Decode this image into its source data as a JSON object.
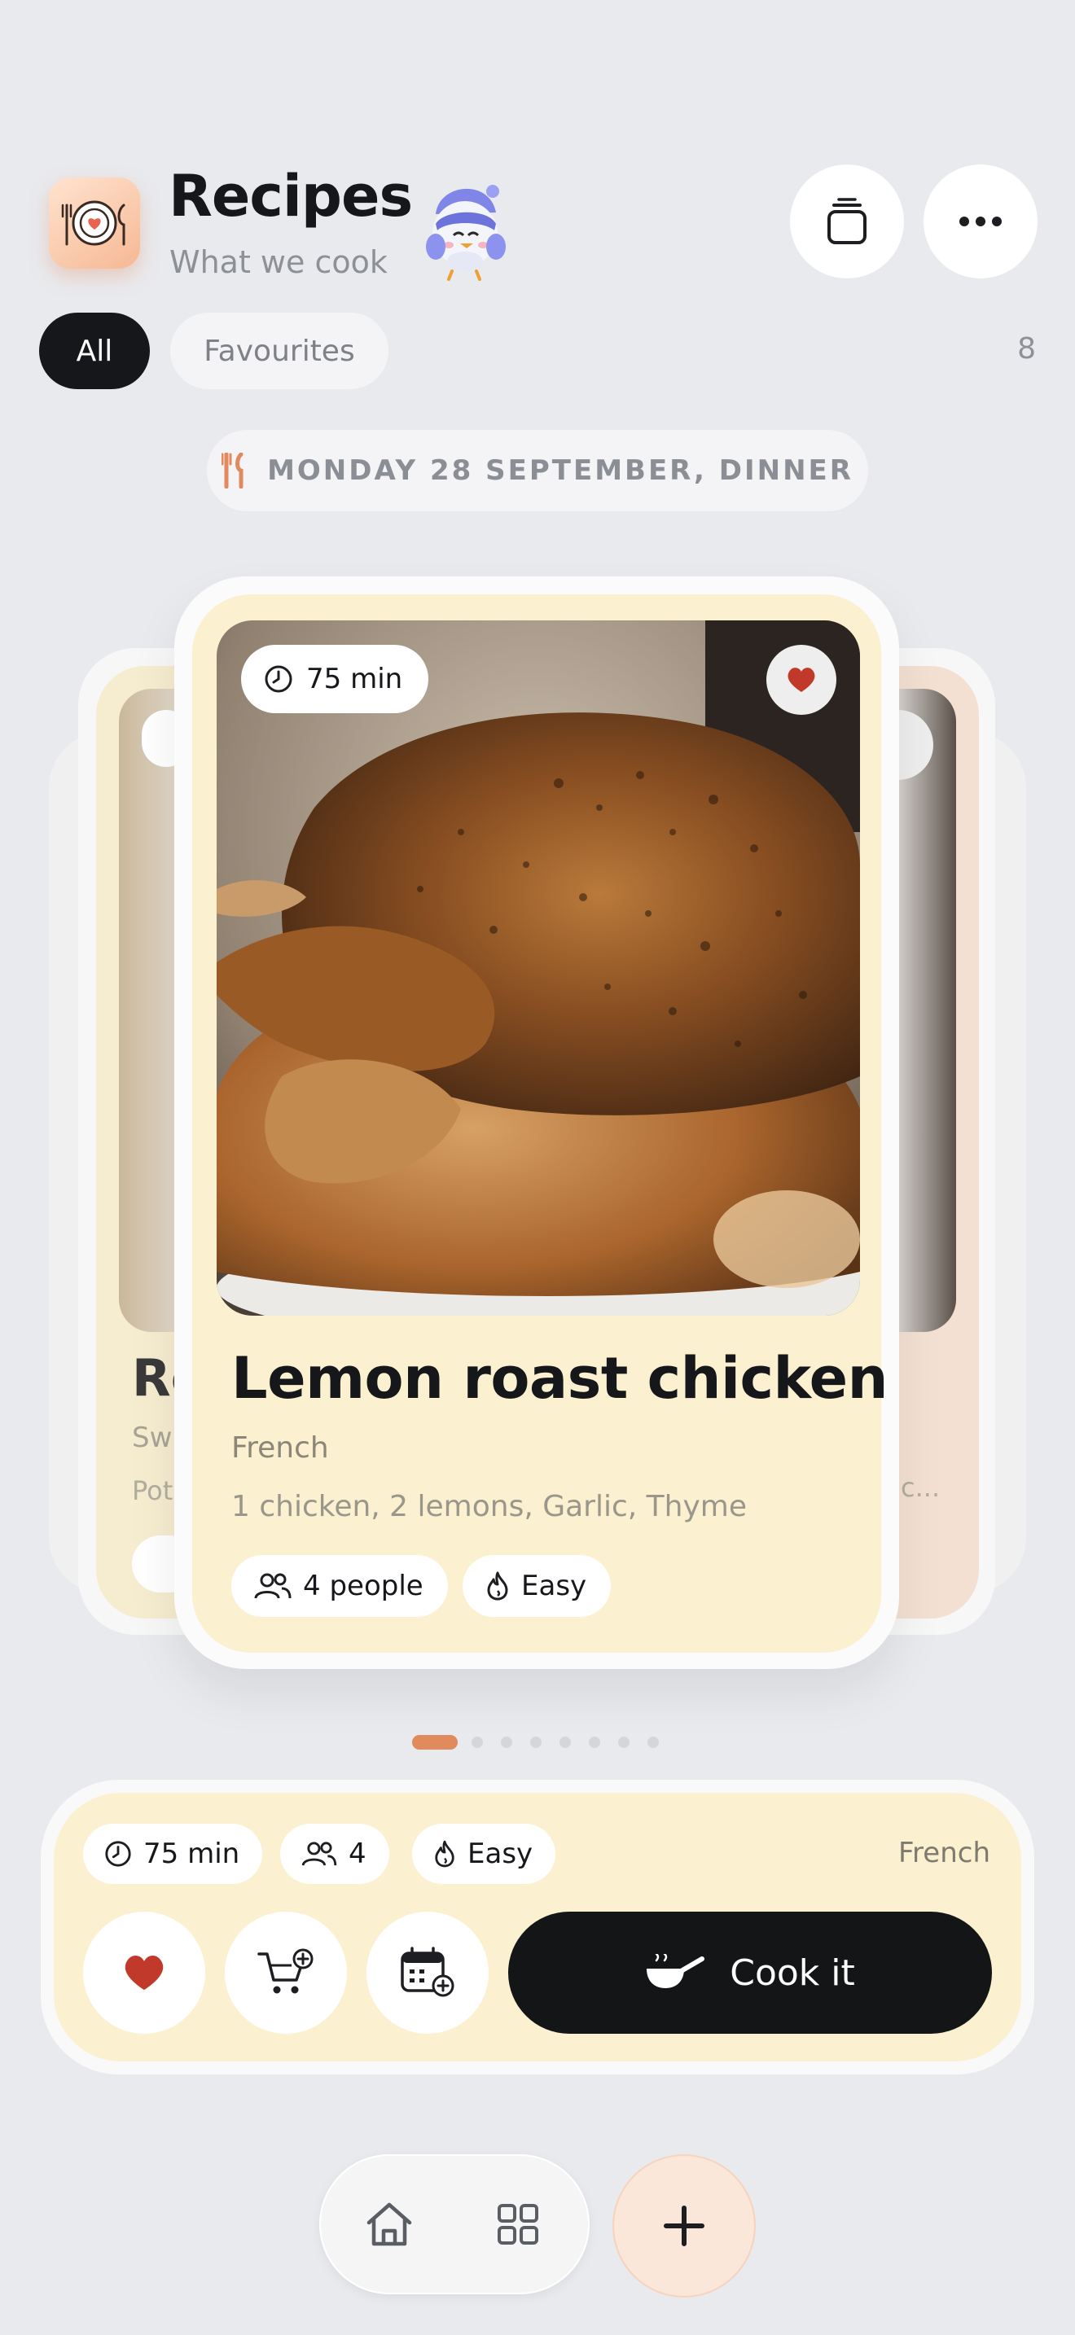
{
  "header": {
    "title": "Recipes",
    "subtitle": "What we cook",
    "app_icon": "plate-with-heart-icon",
    "mascot": "bird-mascot"
  },
  "toolbar": {
    "stack_icon": "stack-cards-icon",
    "more_icon": "ellipsis-icon"
  },
  "filters": {
    "tabs": [
      {
        "label": "All",
        "selected": true
      },
      {
        "label": "Favourites",
        "selected": false
      }
    ],
    "count": "8"
  },
  "meal_banner": {
    "icon": "fork-knife-icon",
    "text": "MONDAY 28 SEPTEMBER, DINNER"
  },
  "left_card_peek": {
    "title_fragment": "Re",
    "subtitle_fragment": "Sw",
    "ingredients_fragment": "Pot"
  },
  "right_card_peek": {
    "ingredients_fragment": "c..."
  },
  "featured_recipe": {
    "time": "75 min",
    "favourite": true,
    "name": "Lemon roast chicken",
    "cuisine": "French",
    "ingredients": "1 chicken, 2 lemons, Garlic, Thyme",
    "people": "4 people",
    "difficulty": "Easy"
  },
  "pagination": {
    "total": 8,
    "active_index": 0
  },
  "action_panel": {
    "time": "75 min",
    "people": "4",
    "difficulty": "Easy",
    "cuisine": "French",
    "cook_label": "Cook it"
  },
  "colors": {
    "background": "#e9eaee",
    "card": "#fbf0cf",
    "accent": "#e08a5d",
    "heart": "#c0392b",
    "dark": "#141517"
  },
  "bottom_nav": {
    "items": [
      "home-icon",
      "grid-icon"
    ],
    "add": "plus-icon"
  }
}
